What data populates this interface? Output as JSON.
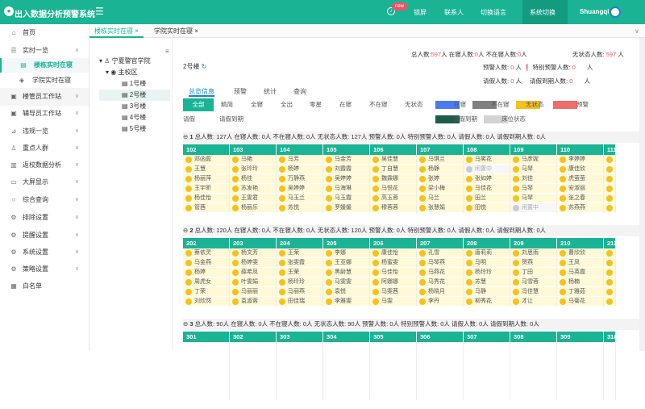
{
  "app": {
    "title": "出入数据分析预警系统",
    "topnav": [
      "锁屏",
      "联系人",
      "切换语言",
      "系统切换"
    ],
    "username": "Shuangqi",
    "new_badge": "new"
  },
  "sidebar": {
    "items": [
      {
        "label": "首页",
        "icon": "home-icon"
      },
      {
        "label": "实时一览",
        "icon": "list-icon",
        "arrow": "∧"
      },
      {
        "label": "楼栋实时在寝",
        "sub": true,
        "active": true
      },
      {
        "label": "学院实时在寝",
        "sub": true
      },
      {
        "label": "楼管员工作站",
        "icon": "briefcase-icon",
        "arrow": "∨"
      },
      {
        "label": "辅导员工作站",
        "icon": "briefcase-icon",
        "arrow": "∨"
      },
      {
        "label": "违规一览",
        "icon": "chart-icon",
        "arrow": "∨"
      },
      {
        "label": "重点人群",
        "icon": "user-icon",
        "arrow": "∨"
      },
      {
        "label": "返校数据分析",
        "icon": "analysis-icon",
        "arrow": "∨"
      },
      {
        "label": "大屏显示",
        "icon": "monitor-icon",
        "arrow": "∨"
      },
      {
        "label": "综合查询",
        "icon": "search-icon",
        "arrow": "∨"
      },
      {
        "label": "排除设置",
        "icon": "gear-icon",
        "arrow": "∨"
      },
      {
        "label": "提醒设置",
        "icon": "gear-icon",
        "arrow": "∨"
      },
      {
        "label": "系统设置",
        "icon": "gear-icon",
        "arrow": "∨"
      },
      {
        "label": "策略设置",
        "icon": "gear-icon",
        "arrow": "∨"
      },
      {
        "label": "白名单",
        "icon": "grid-icon"
      }
    ]
  },
  "tabs": [
    {
      "label": "楼栋实时在寝",
      "active": true
    },
    {
      "label": "学院实时在寝",
      "active": false
    }
  ],
  "tree": {
    "root": "宁夏警官学院",
    "campus": "主校区",
    "buildings": [
      "1号楼",
      "2号楼",
      "3号楼",
      "4号楼",
      "5号楼"
    ],
    "selected": "2号楼"
  },
  "building": "2号楼",
  "summary": {
    "line1": [
      "总人数:",
      "597",
      "人 在寝人数:",
      "0",
      "人 不在寝人数:",
      "0",
      "人",
      "无状态人数:",
      "597",
      "人"
    ],
    "line2": [
      "预警人数:",
      "0",
      "人",
      "特别预警人数:",
      "0",
      "人"
    ],
    "line3": [
      "请假人数:",
      "0",
      "人",
      "请假到期人数:",
      "0",
      "人"
    ]
  },
  "subtabs": [
    "总览信息",
    "预警",
    "统计",
    "查询"
  ],
  "filters": [
    "全部",
    "精简",
    "全寝",
    "全出",
    "零星",
    "在寝",
    "不在寝",
    "无状态",
    "请假",
    "请假到期"
  ],
  "legend": [
    {
      "label": "在寝",
      "color": "#4b7bec"
    },
    {
      "label": "不在寝",
      "color": "#808080"
    },
    {
      "label": "无状态",
      "color": "#f5c11c"
    },
    {
      "label": "预警",
      "color": "#f06c6c"
    },
    {
      "label": "请假到期",
      "color": "#1a5e4a"
    },
    {
      "label": "床位状态",
      "color": "#d3d3d3"
    }
  ],
  "floors": [
    {
      "no": "1",
      "stats": "总人数: 127人 在寝人数: 0人 不在寝人数: 0人 无状态人数: 127人 预警人数: 0人 特别预警人数: 0人 请假人数: 0人 请假到期人数: 0人",
      "rooms": [
        {
          "no": "102",
          "beds": [
            "邓函盈",
            "王慧",
            "杨丽萍",
            "王宇昕",
            "杨佳怡",
            "管茜"
          ]
        },
        {
          "no": "103",
          "beds": [
            "马艳",
            "张玲玲",
            "杨佳",
            "苏发艳",
            "王雯君",
            "杨丽乐"
          ]
        },
        {
          "no": "104",
          "beds": [
            "马芳",
            "杨婷",
            "万静燕",
            "吴婷婷",
            "马玉兰",
            "苏悦"
          ]
        },
        {
          "no": "105",
          "beds": [
            "马金芳",
            "刘霞霞",
            "吴婷婷",
            "马海琳",
            "马玉霞",
            "罗媛媛"
          ]
        },
        {
          "no": "106",
          "beds": [
            "吴佳慧",
            "丁自慧",
            "魏霖娜",
            "马悦花",
            "高玉蓉",
            "穆蓉蓉"
          ]
        },
        {
          "no": "107",
          "beds": [
            "马琪兰",
            "杨静",
            "张婷",
            "梁小梅",
            "马兰",
            "张慧娟"
          ]
        },
        {
          "no": "108",
          "beds": [
            "马笑花",
            "闲置中",
            "张如婷",
            "马佳花",
            "田兰",
            "田悦"
          ]
        },
        {
          "no": "109",
          "beds": [
            "马彦妮",
            "马琴",
            "刘佳",
            "马琴",
            "马琴",
            "闲置中"
          ]
        },
        {
          "no": "110",
          "beds": [
            "李婷婷",
            "康佳欣",
            "虎萤萤",
            "安淑丽",
            "张之春",
            "苏燕燕"
          ]
        },
        {
          "no": "111",
          "beds": [
            "",
            "",
            "",
            "",
            "",
            ""
          ]
        }
      ]
    },
    {
      "no": "2",
      "stats": "总人数: 120人 在寝人数: 0人 不在寝人数: 0人 无状态人数: 120人 预警人数: 0人 特别预警人数: 0人 请假人数: 0人 请假到期人数: 0人",
      "rooms": [
        {
          "no": "202",
          "beds": [
            "蔡依灵",
            "马金燕",
            "杨婷",
            "周虎女",
            "丁荣",
            "刘欣然"
          ]
        },
        {
          "no": "203",
          "beds": [
            "杨文芳",
            "杨婷雯",
            "薛希凤",
            "叶雯娟",
            "马丽丽",
            "袁淑蓉"
          ]
        },
        {
          "no": "204",
          "beds": [
            "王荣",
            "张雯霞",
            "王荣",
            "杨玲玲",
            "马丽燕",
            "田佳瑞"
          ]
        },
        {
          "no": "205",
          "beds": [
            "李娜",
            "王亚娜",
            "黑尉慧",
            "马雯雯",
            "袁悦",
            "李雅雯"
          ]
        },
        {
          "no": "206",
          "beds": [
            "康佳怡",
            "杨蜜雯",
            "马佳怡",
            "阿娜娜",
            "马雯茜",
            "马雯"
          ]
        },
        {
          "no": "207",
          "beds": [
            "孔雪",
            "马琴燕",
            "马燕花",
            "马秀花",
            "杨晓月",
            "李丹"
          ]
        },
        {
          "no": "208",
          "beds": [
            "唐莉莉",
            "马明",
            "杨玲玲",
            "苏慧",
            "马静",
            "柳秀花"
          ]
        },
        {
          "no": "209",
          "beds": [
            "刘思雨",
            "贺燕",
            "丁田",
            "马雪蓉",
            "冯佳慧",
            "才让"
          ]
        },
        {
          "no": "210",
          "beds": [
            "曹欣欣",
            "王凤",
            "马英霞",
            "杨楠",
            "丁雅茹",
            "马菊花"
          ]
        },
        {
          "no": "211",
          "beds": [
            "",
            "",
            "",
            "",
            "",
            ""
          ]
        }
      ]
    },
    {
      "no": "3",
      "stats": "总人数: 90人 在寝人数: 0人 不在寝人数: 0人 无状态人数: 90人 预警人数: 0人 特别预警人数: 0人 请假人数: 0人 请假到期人数: 0人",
      "rooms": [
        {
          "no": "301",
          "beds": []
        },
        {
          "no": "302",
          "beds": []
        },
        {
          "no": "303",
          "beds": []
        },
        {
          "no": "304",
          "beds": []
        },
        {
          "no": "305",
          "beds": []
        },
        {
          "no": "306",
          "beds": []
        },
        {
          "no": "307",
          "beds": []
        },
        {
          "no": "308",
          "beds": []
        },
        {
          "no": "309",
          "beds": []
        },
        {
          "no": "310",
          "beds": []
        }
      ]
    }
  ]
}
